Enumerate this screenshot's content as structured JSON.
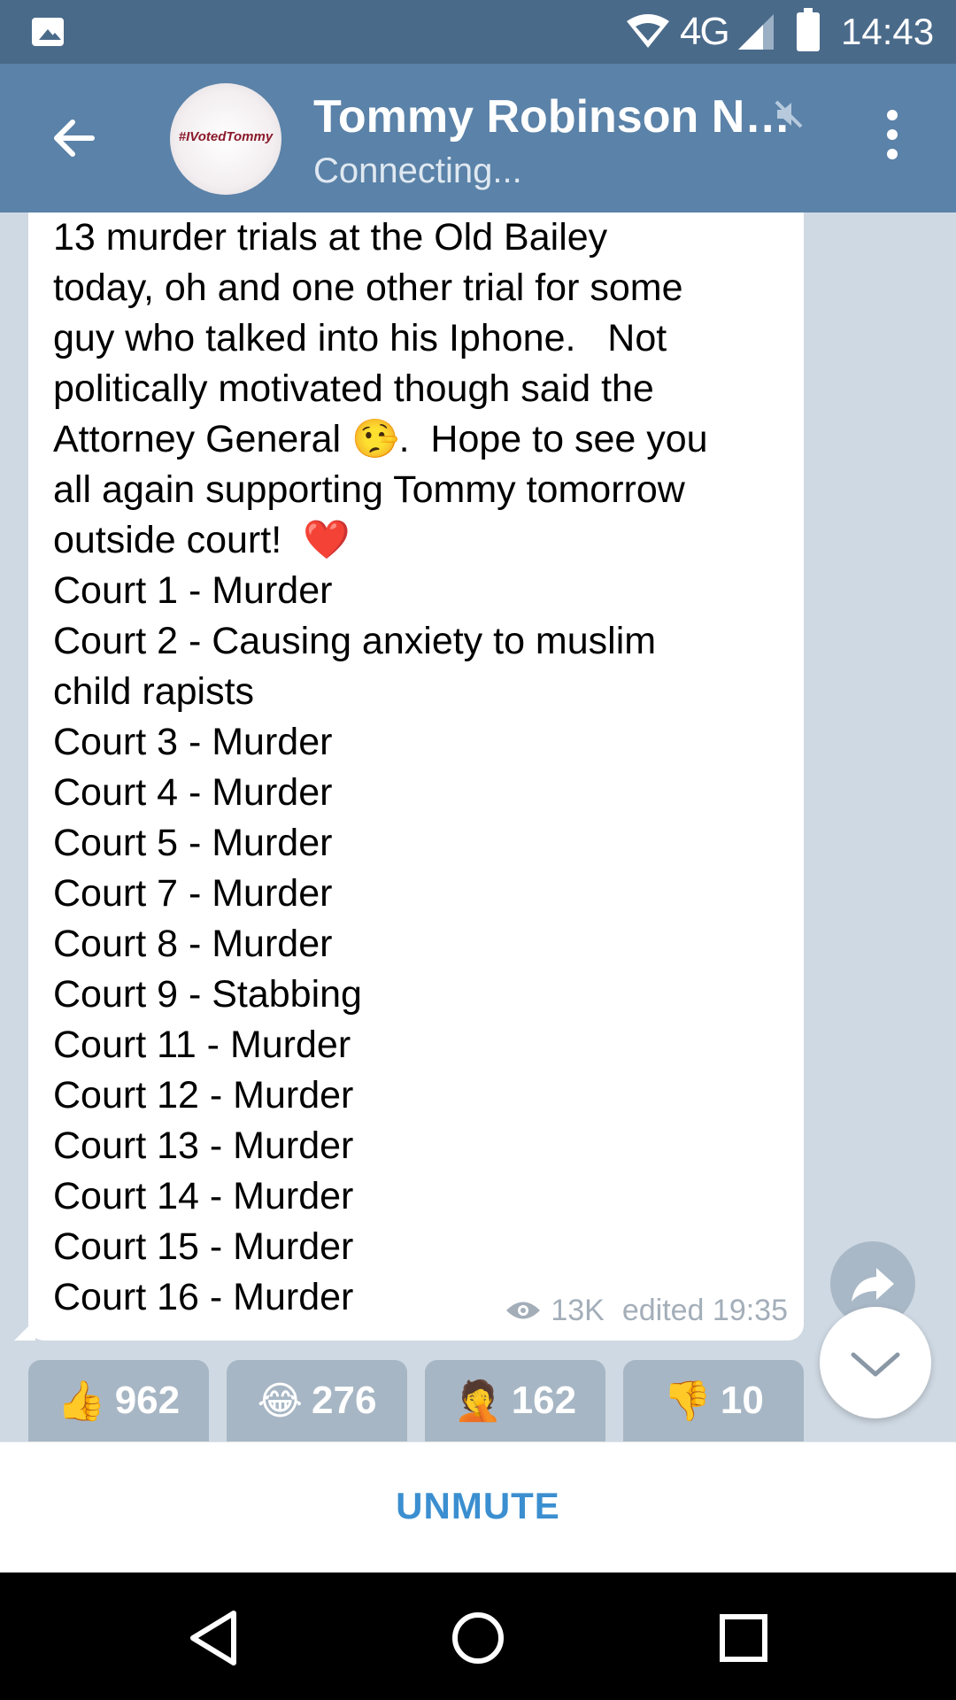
{
  "status_bar": {
    "network": "4G",
    "time": "14:43",
    "icons": [
      "gallery-icon",
      "wifi-icon",
      "signal-icon",
      "battery-icon"
    ]
  },
  "header": {
    "title": "Tommy Robinson N…",
    "subtitle": "Connecting...",
    "avatar_text": "#IVotedTommy",
    "icons": [
      "back-arrow-icon",
      "muted-speaker-icon",
      "more-vert-icon"
    ]
  },
  "message": {
    "lines": [
      "13 murder trials at the Old Bailey",
      "today, oh and one other trial for some",
      "guy who talked into his Iphone.   Not",
      "politically motivated though said the",
      "Attorney General ",
      "🤥",
      ".  Hope to see you",
      "all again supporting Tommy tomorrow",
      "outside court!  ",
      "❤️",
      "Court 1 - Murder",
      "Court 2 - Causing anxiety to muslim",
      "child rapists",
      "Court 3 - Murder",
      "Court 4 - Murder",
      "Court 5 - Murder",
      "Court 7 - Murder",
      "Court 8 - Murder",
      "Court 9 - Stabbing",
      "Court 11 - Murder",
      "Court 12 - Murder",
      "Court 13 - Murder",
      "Court 14 - Murder",
      "Court 15 - Murder",
      "Court 16 - Murder"
    ],
    "views": "13K",
    "edited": "edited 19:35"
  },
  "reactions": [
    {
      "emoji": "👍",
      "count": "962",
      "icon": "thumbs-up-icon"
    },
    {
      "emoji": "😂",
      "count": "276",
      "icon": "laughing-icon"
    },
    {
      "emoji": "🤦",
      "count": "162",
      "icon": "facepalm-icon"
    },
    {
      "emoji": "👎",
      "count": "10",
      "icon": "thumbs-down-icon"
    }
  ],
  "bottom": {
    "unmute_label": "UNMUTE"
  },
  "colors": {
    "status_bar": "#4a6a8a",
    "app_bar": "#5b82a8",
    "chat_bg": "#cfd9e3",
    "accent": "#3b8fd0",
    "reaction_bg": "#a7b6c4"
  }
}
